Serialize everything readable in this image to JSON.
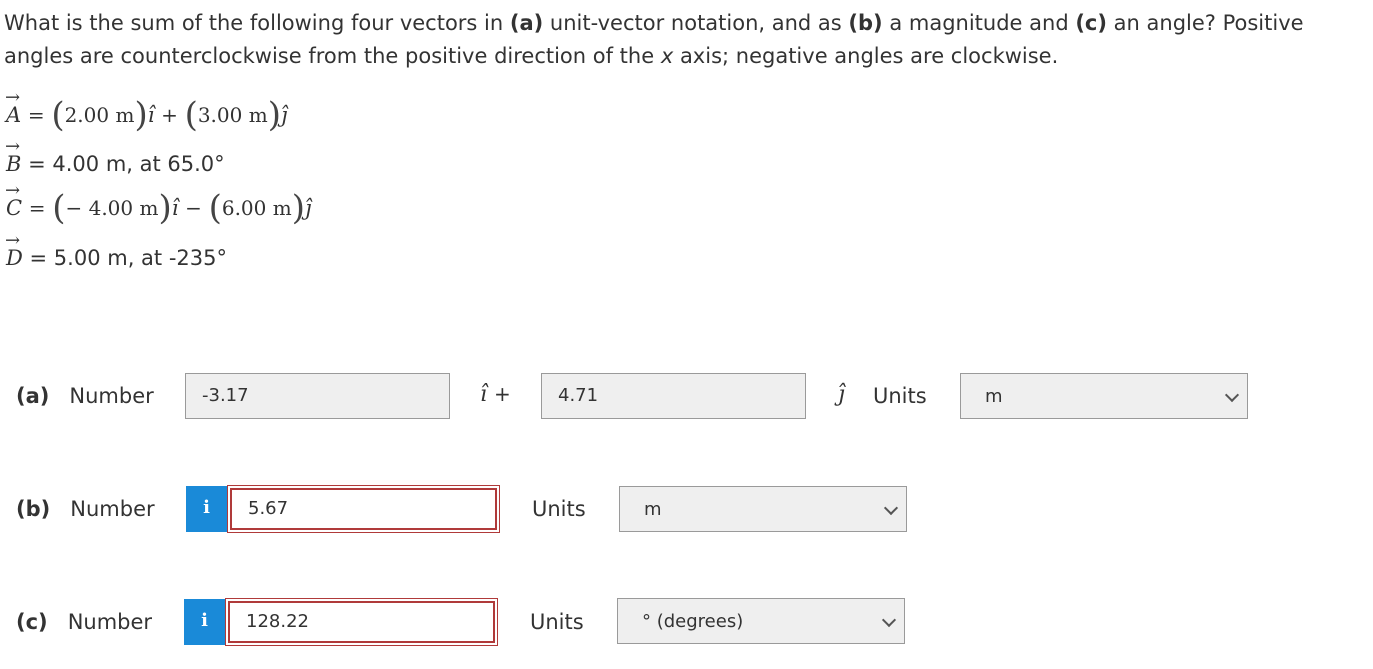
{
  "question": {
    "part1": "What is the sum of the following four vectors in ",
    "a_tag": "(a)",
    "part2": " unit-vector notation, and as ",
    "b_tag": "(b)",
    "part3": " a magnitude and ",
    "c_tag": "(c)",
    "part4": " an angle? Positive angles are counterclockwise from the positive direction of the ",
    "x_var": "x",
    "part5": " axis; negative angles are clockwise."
  },
  "vectors": {
    "a": {
      "name": "A",
      "eq": "=",
      "x": "2.00 m",
      "op": "+",
      "y": "3.00 m",
      "i": "î",
      "j": "ĵ"
    },
    "b": {
      "name": "B",
      "text": "= 4.00 m, at 65.0°"
    },
    "c": {
      "name": "C",
      "eq": "=",
      "x": "− 4.00 m",
      "op": "−",
      "y": "6.00 m",
      "i": "î",
      "j": "ĵ"
    },
    "d": {
      "name": "D",
      "text": "= 5.00 m, at -235°"
    }
  },
  "answers": {
    "a": {
      "tag": "(a)",
      "label": "Number",
      "x_value": "-3.17",
      "i_sym": "î",
      "plus": "+",
      "y_value": "4.71",
      "j_sym": "ĵ",
      "units_label": "Units",
      "unit": "m"
    },
    "b": {
      "tag": "(b)",
      "label": "Number",
      "info": "i",
      "value": "5.67",
      "units_label": "Units",
      "unit": "m"
    },
    "c": {
      "tag": "(c)",
      "label": "Number",
      "info": "i",
      "value": "128.22",
      "units_label": "Units",
      "unit": "° (degrees)"
    }
  },
  "colors": {
    "info_button": "#1a8ad8",
    "error_border": "#b03a3a",
    "field_bg": "#efefef"
  }
}
